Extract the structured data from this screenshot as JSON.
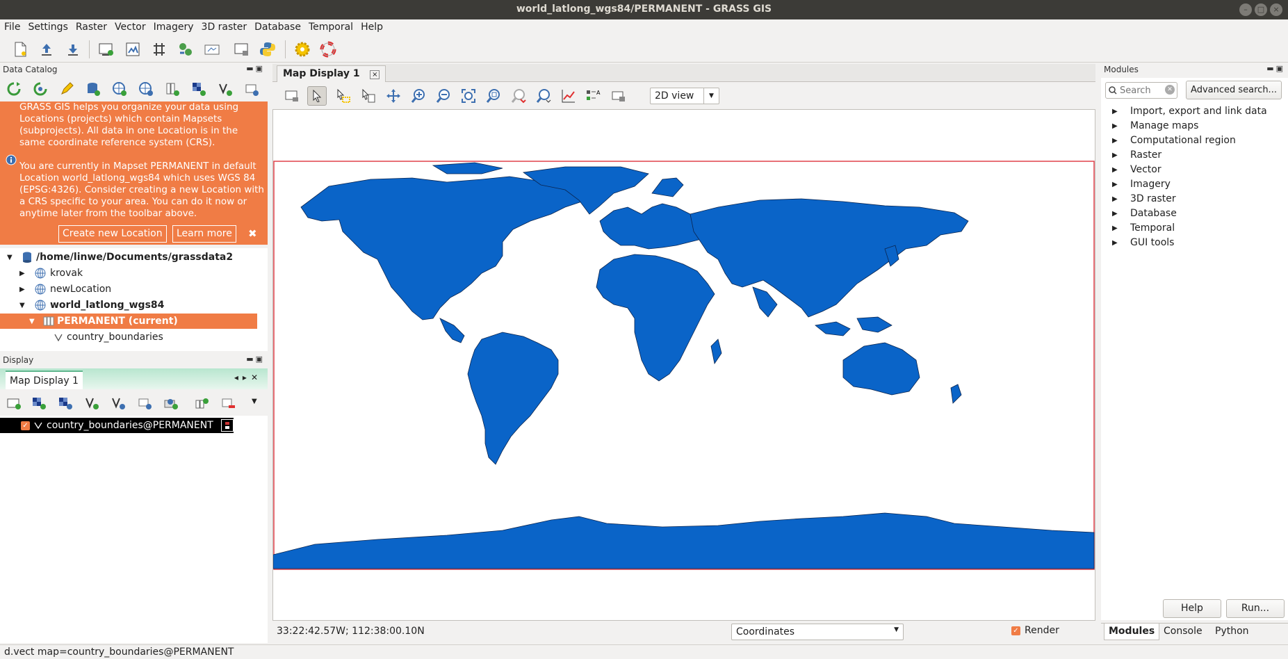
{
  "window": {
    "title": "world_latlong_wgs84/PERMANENT - GRASS GIS",
    "buttons": [
      "–",
      "□",
      "×"
    ]
  },
  "menu": [
    "File",
    "Settings",
    "Raster",
    "Vector",
    "Imagery",
    "3D raster",
    "Database",
    "Temporal",
    "Help"
  ],
  "toolbar": {
    "icons": [
      "new-workspace-icon",
      "open-workspace-icon",
      "save-workspace-icon",
      "new-map-display-icon",
      "georectifier-icon",
      "cartographic-composer-icon",
      "graphical-modeler-icon",
      "map-swipe-icon",
      "rdigit-icon",
      "python-shell-icon",
      "settings-gear-icon",
      "help-lifebuoy-icon"
    ]
  },
  "data_catalog": {
    "header": "Data Catalog",
    "info": {
      "paragraph1": "GRASS GIS helps you organize your data using Locations (projects) which contain Mapsets (subprojects). All data in one Location is in the same coordinate reference system (CRS).",
      "paragraph2": "You are currently in Mapset PERMANENT in default Location world_latlong_wgs84 which uses WGS 84 (EPSG:4326). Consider creating a new Location with a CRS specific to your area. You can do it now or anytime later from the toolbar above.",
      "create_button": "Create new Location",
      "learn_button": "Learn more",
      "close": "✖"
    },
    "tree": {
      "root": "/home/linwe/Documents/grassdata2",
      "loc1": "krovak",
      "loc2": "newLocation",
      "loc3": "world_latlong_wgs84",
      "mapset": "PERMANENT  (current)",
      "layer": "country_boundaries"
    }
  },
  "display_panel": {
    "header": "Display",
    "tab": "Map Display 1",
    "layer": "country_boundaries@PERMANENT"
  },
  "map_display": {
    "tab": "Map Display 1",
    "view_select": "2D view",
    "coords": "33:22:42.57W; 112:38:00.10N",
    "coord_select": "Coordinates",
    "render_label": "Render"
  },
  "modules": {
    "header": "Modules",
    "search_placeholder": "Search",
    "advanced_button": "Advanced search...",
    "items": [
      "Import, export and link data",
      "Manage maps",
      "Computational region",
      "Raster",
      "Vector",
      "Imagery",
      "3D raster",
      "Database",
      "Temporal",
      "GUI tools"
    ],
    "help_button": "Help",
    "run_button": "Run...",
    "tabs": [
      "Modules",
      "Console",
      "Python"
    ]
  },
  "status": "d.vect map=country_boundaries@PERMANENT",
  "colors": {
    "accent": "#f07c45",
    "land": "#0a64c8",
    "region_border": "#e0414a"
  }
}
